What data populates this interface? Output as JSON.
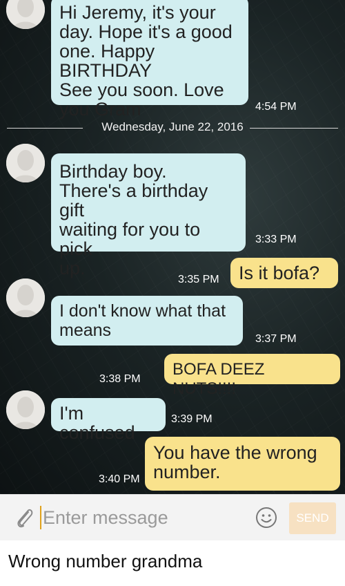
{
  "messages": [
    {
      "id": "m1",
      "sender": "grandma",
      "text": "Hi Jeremy, it's your\nday.  Hope it's a good\none. Happy BIRTHDAY\nSee you soon. Love\nyou Gram",
      "time": "4:54 PM"
    },
    {
      "id": "m2",
      "sender": "grandma",
      "text": "Birthday boy.\nThere's a birthday gift\nwaiting for you to pick\nup.",
      "time": "3:33 PM"
    },
    {
      "id": "m3",
      "sender": "me",
      "text": "Is it bofa?",
      "time": "3:35 PM"
    },
    {
      "id": "m4",
      "sender": "grandma",
      "text": "I don't know what that\nmeans",
      "time": "3:37 PM"
    },
    {
      "id": "m5",
      "sender": "me",
      "text": "BOFA DEEZ NUTS!!!!",
      "time": "3:38 PM"
    },
    {
      "id": "m6",
      "sender": "grandma",
      "text": "I'm confused",
      "time": "3:39 PM"
    },
    {
      "id": "m7",
      "sender": "me",
      "text": "You have the wrong\nnumber.",
      "time": "3:40 PM"
    }
  ],
  "date_divider": "Wednesday, June 22, 2016",
  "composer": {
    "placeholder": "Enter message",
    "send_label": "SEND"
  },
  "caption": "Wrong number grandma",
  "colors": {
    "incoming_bubble": "#d2eef0",
    "outgoing_bubble": "#f9e28c",
    "send_button": "#f7e1c2",
    "cursor": "#e0a21b"
  },
  "icons": {
    "attach": "paperclip-icon",
    "emoji": "smiley-icon",
    "avatar": "person-avatar"
  }
}
